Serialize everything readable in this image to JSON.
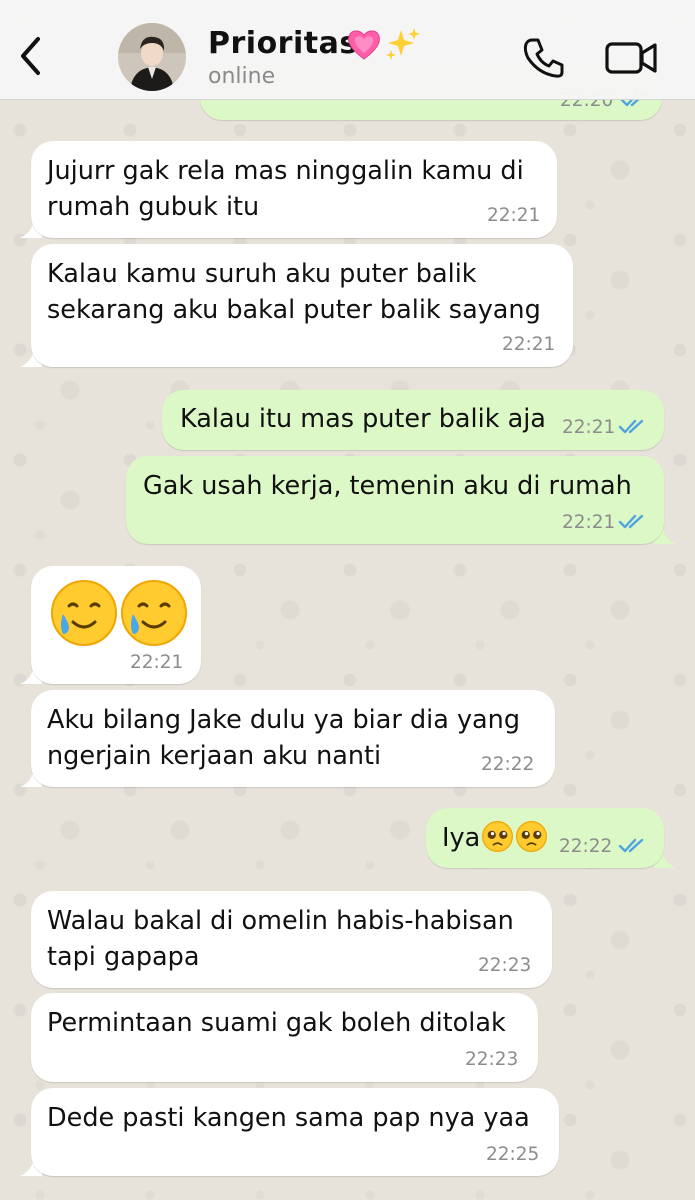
{
  "header": {
    "contact_name": "Prioritas",
    "contact_emoji_1": "💓",
    "contact_emoji_2": "✨",
    "status": "online"
  },
  "messages": [
    {
      "direction": "out",
      "text": "",
      "time": "22:20",
      "read": true
    },
    {
      "direction": "in",
      "text": "Jujurr gak rela mas ninggalin kamu di\nrumah gubuk itu",
      "time": "22:21"
    },
    {
      "direction": "in",
      "text": "Kalau kamu suruh aku puter balik\nsekarang aku bakal puter balik sayang",
      "time": "22:21"
    },
    {
      "direction": "out",
      "text": "Kalau itu mas puter balik aja",
      "time": "22:21",
      "read": true
    },
    {
      "direction": "out",
      "text": "Gak usah kerja, temenin aku di rumah",
      "time": "22:21",
      "read": true
    },
    {
      "direction": "in",
      "emoji": "🥲🥲",
      "time": "22:21"
    },
    {
      "direction": "in",
      "text": "Aku bilang Jake dulu ya biar dia yang\nngerjain kerjaan aku nanti",
      "time": "22:22"
    },
    {
      "direction": "out",
      "text": "Iya",
      "emoji": "🥺🥺",
      "time": "22:22",
      "read": true
    },
    {
      "direction": "in",
      "text": "Walau bakal di omelin habis-habisan\ntapi gapapa",
      "time": "22:23"
    },
    {
      "direction": "in",
      "text": "Permintaan suami gak boleh ditolak",
      "time": "22:23"
    },
    {
      "direction": "in",
      "text": "Dede pasti kangen sama pap nya yaa",
      "time": "22:25"
    }
  ],
  "colors": {
    "incoming_bubble": "#ffffff",
    "outgoing_bubble": "#dcf8c6",
    "read_ticks": "#4fa3e0",
    "timestamp": "#8c8c8c",
    "header_bg": "#f6f6f6"
  },
  "icons": {
    "back": "chevron-left-icon",
    "call": "phone-icon",
    "video": "video-camera-icon",
    "read": "double-check-icon"
  }
}
